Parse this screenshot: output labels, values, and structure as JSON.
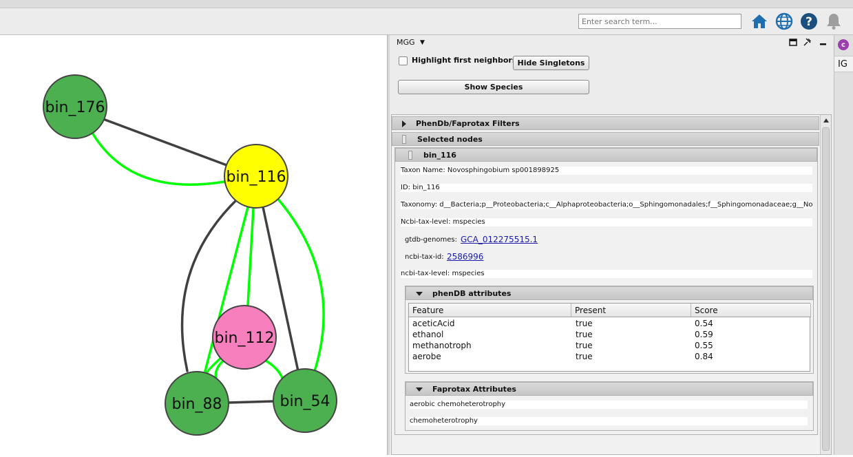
{
  "toolbar": {
    "search_placeholder": "Enter search term...",
    "icons": [
      "home-icon",
      "globe-icon",
      "help-icon",
      "bell-icon"
    ]
  },
  "network": {
    "nodes": [
      {
        "id": "bin_176",
        "label": "bin_176",
        "color": "#4caf50"
      },
      {
        "id": "bin_116",
        "label": "bin_116",
        "color": "#ffff00"
      },
      {
        "id": "bin_112",
        "label": "bin_112",
        "color": "#f77fbe"
      },
      {
        "id": "bin_88",
        "label": "bin_88",
        "color": "#4caf50"
      },
      {
        "id": "bin_54",
        "label": "bin_54",
        "color": "#4caf50"
      }
    ],
    "edge_colors": {
      "positive": "#00ff00",
      "negative": "#404040"
    }
  },
  "panel": {
    "title": "MGG",
    "dropdown_glyph": "▼",
    "highlight_label": "Highlight first neighbors",
    "hide_singletons_label": "Hide Singletons",
    "show_species_label": "Show Species",
    "sections": {
      "filters": "PhenDb/Faprotax Filters",
      "selected_nodes": "Selected nodes",
      "node_name": "bin_116"
    },
    "attributes": {
      "taxon_name": "Taxon Name: Novosphingobium sp001898925",
      "id": "ID: bin_116",
      "taxonomy": "Taxonomy: d__Bacteria;p__Proteobacteria;c__Alphaproteobacteria;o__Sphingomonadales;f__Sphingomonadaceae;g__Novo",
      "ncbi_level_1": "Ncbi-tax-level: mspecies",
      "gtdb_label": "gtdb-genomes:",
      "gtdb_value": "GCA_012275515.1",
      "ncbi_id_label": "ncbi-tax-id:",
      "ncbi_id_value": "2586996",
      "ncbi_level_2": "ncbi-tax-level: mspecies"
    },
    "phendb": {
      "title": "phenDB attributes",
      "headers": [
        "Feature",
        "Present",
        "Score"
      ],
      "rows": [
        [
          "aceticAcid",
          "true",
          "0.54"
        ],
        [
          "ethanol",
          "true",
          "0.59"
        ],
        [
          "methanotroph",
          "true",
          "0.55"
        ],
        [
          "aerobe",
          "true",
          "0.84"
        ]
      ]
    },
    "faprotax": {
      "title": "Faprotax Attributes",
      "items": [
        "aerobic chemoheterotrophy",
        "chemoheterotrophy"
      ]
    }
  },
  "right_strip": {
    "badge": "c",
    "tab": "IG"
  }
}
